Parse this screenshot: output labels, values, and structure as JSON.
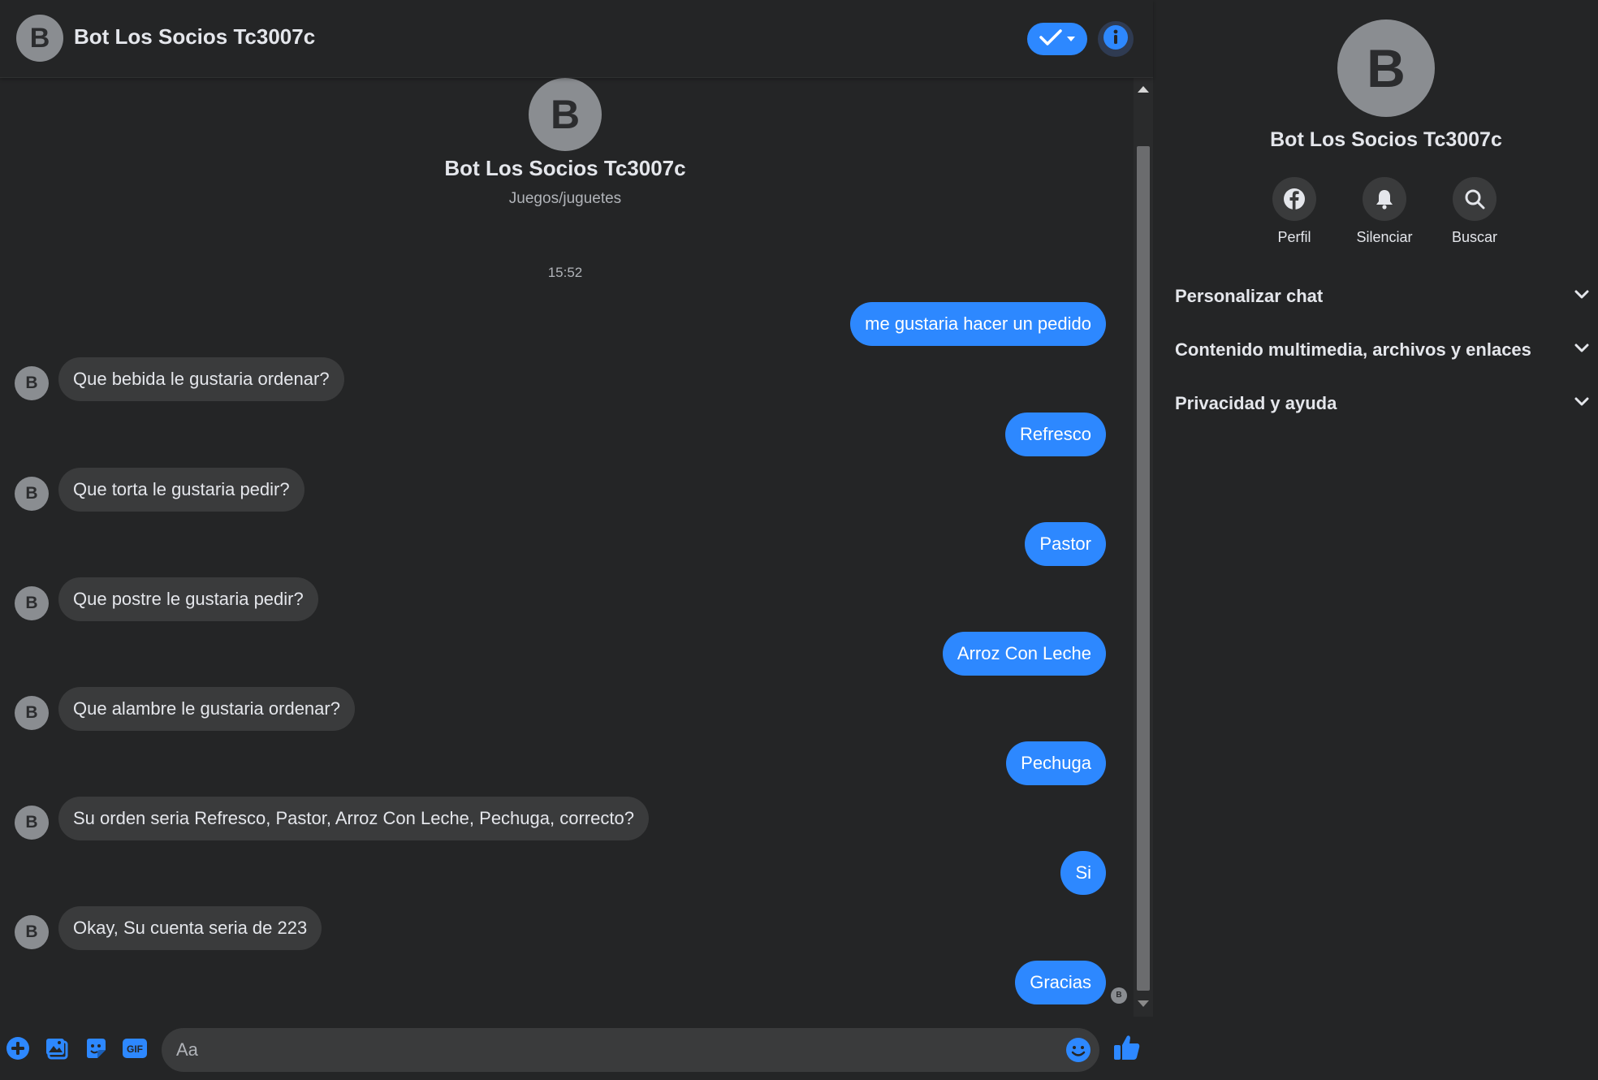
{
  "header": {
    "avatar_letter": "B",
    "name": "Bot Los Socios Tc3007c"
  },
  "intro": {
    "avatar_letter": "B",
    "name": "Bot Los Socios Tc3007c",
    "category": "Juegos/juguetes"
  },
  "timestamp": "15:52",
  "messages": [
    {
      "from": "me",
      "text": "me gustaria hacer un pedido"
    },
    {
      "from": "bot",
      "text": "Que bebida le gustaria ordenar?"
    },
    {
      "from": "me",
      "text": "Refresco"
    },
    {
      "from": "bot",
      "text": "Que torta le gustaria pedir?"
    },
    {
      "from": "me",
      "text": "Pastor"
    },
    {
      "from": "bot",
      "text": "Que postre le gustaria pedir?"
    },
    {
      "from": "me",
      "text": "Arroz Con Leche"
    },
    {
      "from": "bot",
      "text": "Que alambre le gustaria ordenar?"
    },
    {
      "from": "me",
      "text": "Pechuga"
    },
    {
      "from": "bot",
      "text": "Su orden seria Refresco, Pastor, Arroz Con Leche, Pechuga, correcto?"
    },
    {
      "from": "me",
      "text": "Si"
    },
    {
      "from": "bot",
      "text": "Okay, Su cuenta seria de 223"
    },
    {
      "from": "me",
      "text": "Gracias"
    }
  ],
  "bot_avatar_letter": "B",
  "composer": {
    "placeholder": "Aa",
    "icons": [
      "plus-icon",
      "photo-icon",
      "sticker-icon",
      "gif-icon",
      "emoji-icon",
      "like-icon"
    ],
    "gif_label": "GIF"
  },
  "info_panel": {
    "avatar_letter": "B",
    "name": "Bot Los Socios Tc3007c",
    "actions": [
      {
        "icon": "facebook-icon",
        "label": "Perfil"
      },
      {
        "icon": "bell-icon",
        "label": "Silenciar"
      },
      {
        "icon": "search-icon",
        "label": "Buscar"
      }
    ],
    "sections": [
      {
        "title": "Personalizar chat"
      },
      {
        "title": "Contenido multimedia, archivos y enlaces"
      },
      {
        "title": "Privacidad y ayuda"
      }
    ]
  },
  "colors": {
    "accent": "#2d88ff",
    "background": "#242526",
    "bubble_incoming": "#3a3b3c",
    "text": "#e4e6eb"
  }
}
